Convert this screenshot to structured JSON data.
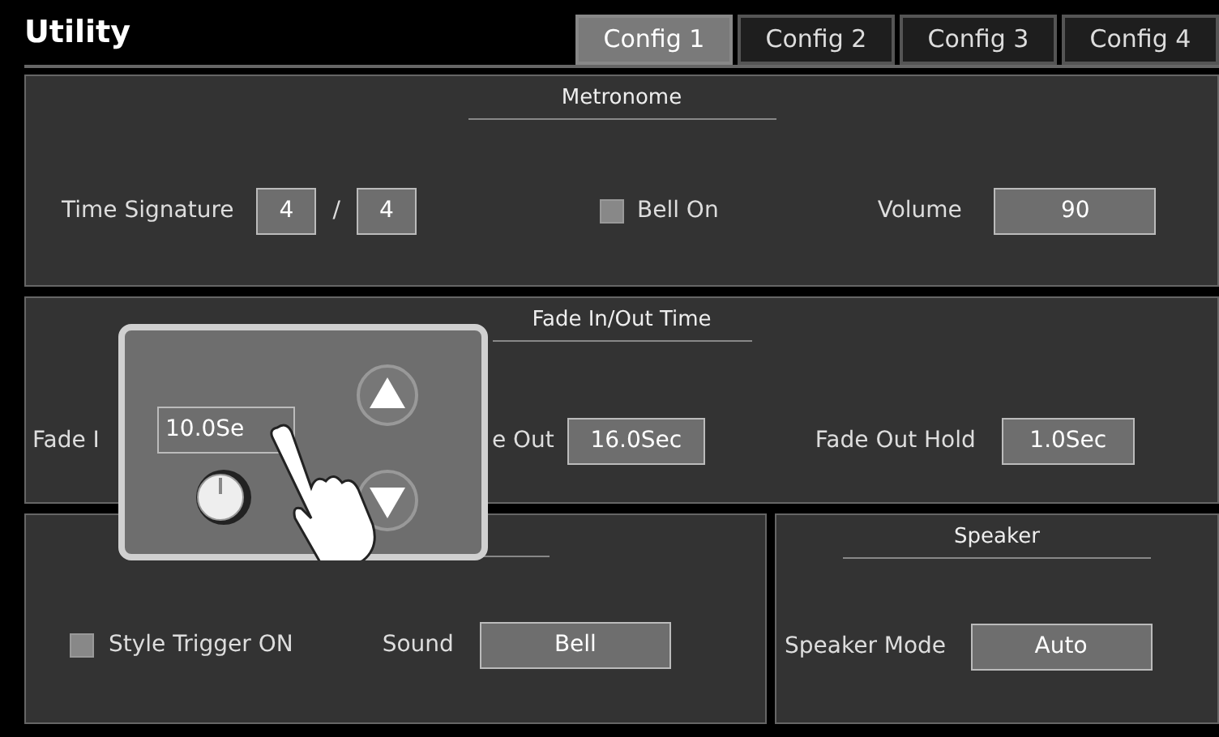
{
  "header": {
    "title": "Utility"
  },
  "tabs": [
    {
      "label": "Config 1",
      "selected": true
    },
    {
      "label": "Config 2",
      "selected": false
    },
    {
      "label": "Config 3",
      "selected": false
    },
    {
      "label": "Config 4",
      "selected": false
    }
  ],
  "metronome": {
    "title": "Metronome",
    "time_signature_label": "Time Signature",
    "numerator": "4",
    "separator": "/",
    "denominator": "4",
    "bell": {
      "label": "Bell On",
      "checked": false
    },
    "volume_label": "Volume",
    "volume": "90"
  },
  "fade": {
    "title": "Fade In/Out Time",
    "fade_in_label": "Fade I",
    "fade_out_label": "e Out",
    "fade_out": "16.0Sec",
    "fade_out_hold_label": "Fade Out Hold",
    "fade_out_hold": "1.0Sec"
  },
  "popup": {
    "value": "10.0Se"
  },
  "style_trigger": {
    "checkbox": {
      "label": "Style Trigger ON",
      "checked": false
    },
    "sound_label": "Sound",
    "sound": "Bell"
  },
  "speaker": {
    "title": "Speaker",
    "mode_label": "Speaker Mode",
    "mode": "Auto"
  }
}
